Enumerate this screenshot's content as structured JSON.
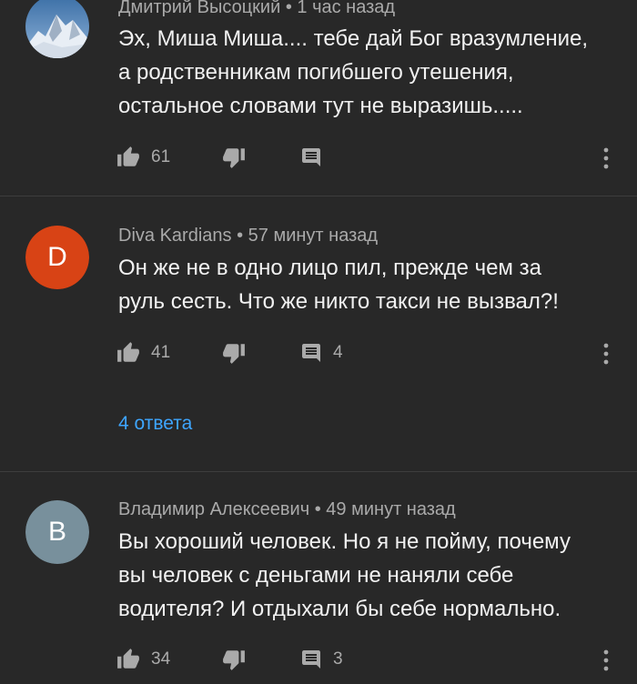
{
  "comments": [
    {
      "author": "Дмитрий Высоцкий",
      "time": "1 час назад",
      "lines": [
        "Эх, Миша Миша.... тебе дай Бог вразумление,",
        "а родственникам  погибшего утешения,",
        "остальное словами тут не выразишь....."
      ],
      "likes": "61",
      "reply_count": "",
      "avatar_kind": "mountain-photo"
    },
    {
      "author": "Diva Kardians",
      "time": "57 минут назад",
      "lines": [
        "Он же не в одно лицо пил, прежде чем за",
        "руль сесть. Что же никто такси не вызвал?!"
      ],
      "likes": "41",
      "reply_count": "4",
      "avatar_letter": "D",
      "avatar_color": "#d84315",
      "replies_link": "4 ответа"
    },
    {
      "author": "Владимир Алексеевич",
      "time": "49 минут назад",
      "lines": [
        "Вы хороший человек. Но я не пойму, почему",
        "вы человек с деньгами не наняли себе",
        "водителя? И отдыхали бы себе нормально."
      ],
      "likes": "34",
      "reply_count": "3",
      "avatar_letter": "B",
      "avatar_color": "#78909c"
    }
  ],
  "meta_separator": "•",
  "icons": {
    "like": "thumbs-up-icon",
    "dislike": "thumbs-down-icon",
    "reply": "comment-icon",
    "more": "more-vertical-icon"
  },
  "colors": {
    "background": "#282828",
    "text": "#f1f1f1",
    "secondary": "#aaaaaa",
    "link": "#3ea6ff"
  }
}
